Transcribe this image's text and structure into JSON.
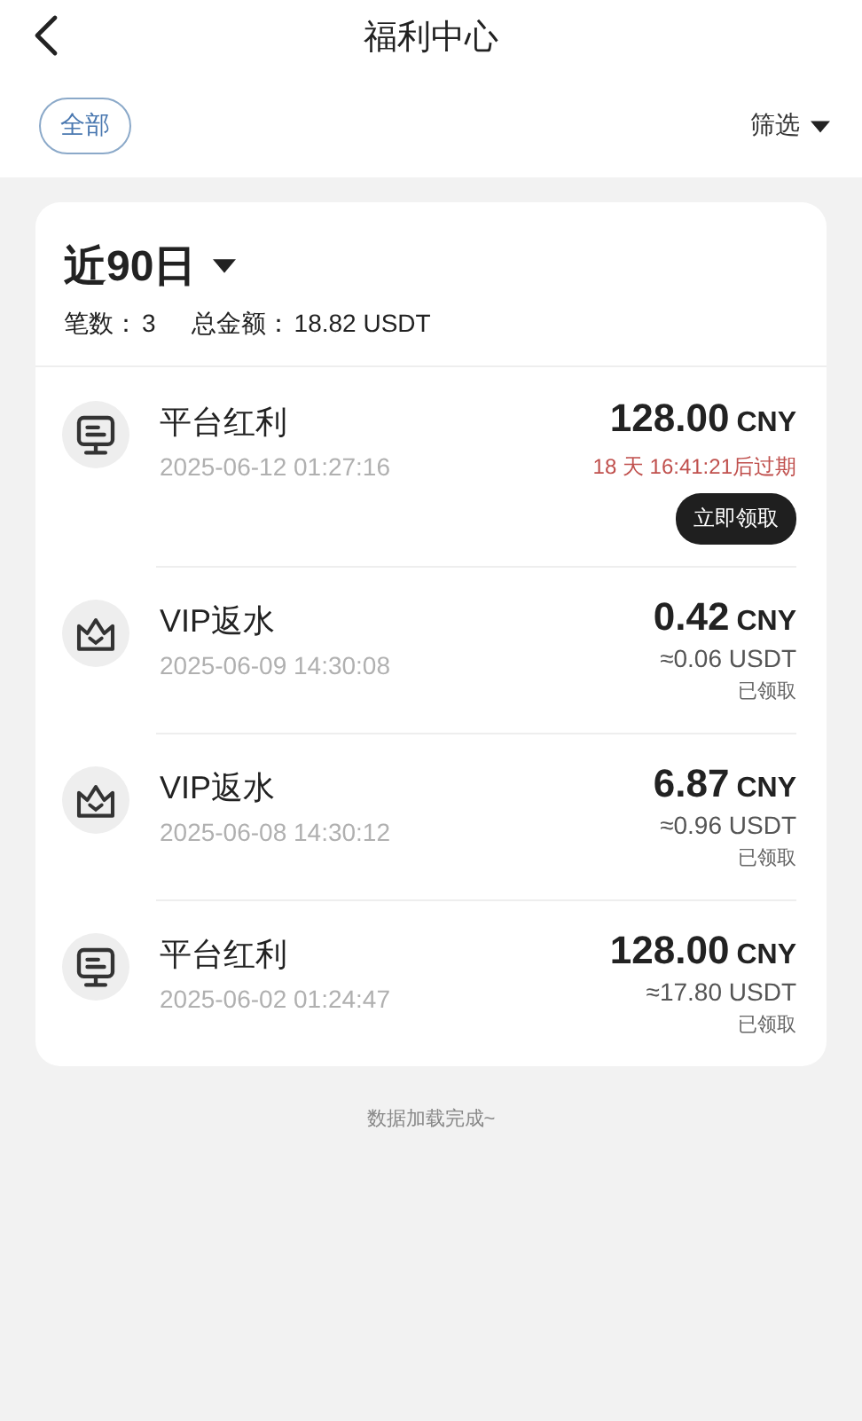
{
  "header": {
    "title": "福利中心"
  },
  "filter_bar": {
    "chip": {
      "label": "全部",
      "selected": true
    },
    "filter": {
      "label": "筛选"
    }
  },
  "summary": {
    "period": "近90日",
    "count_label": "笔数：",
    "count": "3",
    "total_label": "总金额：",
    "total": "18.82 USDT"
  },
  "records": [
    {
      "kind": "bonus",
      "title": "平台红利",
      "time": "2025-06-12 01:27:16",
      "amount": "128.00",
      "currency": "CNY",
      "expiry": "18 天 16:41:21后过期",
      "action": "立即领取"
    },
    {
      "kind": "rebate",
      "title": "VIP返水",
      "time": "2025-06-09 14:30:08",
      "amount": "0.42",
      "currency": "CNY",
      "converted": "≈0.06 USDT",
      "status": "已领取"
    },
    {
      "kind": "rebate",
      "title": "VIP返水",
      "time": "2025-06-08 14:30:12",
      "amount": "6.87",
      "currency": "CNY",
      "converted": "≈0.96 USDT",
      "status": "已领取"
    },
    {
      "kind": "bonus",
      "title": "平台红利",
      "time": "2025-06-02 01:24:47",
      "amount": "128.00",
      "currency": "CNY",
      "converted": "≈17.80 USDT",
      "status": "已领取"
    }
  ],
  "footer": "数据加载完成~"
}
